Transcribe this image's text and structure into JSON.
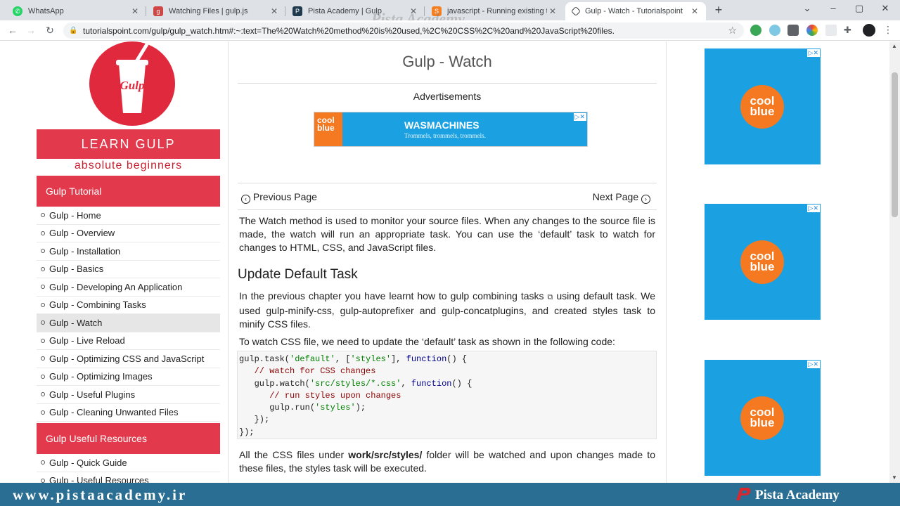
{
  "browser": {
    "tabs": [
      {
        "label": "WhatsApp",
        "color": "#25d366"
      },
      {
        "label": "Watching Files | gulp.js",
        "color": "#cf4647"
      },
      {
        "label": "Pista Academy | Gulp",
        "color": "#1f3a4d"
      },
      {
        "label": "javascript - Running existing task",
        "color": "#f48024"
      },
      {
        "label": "Gulp - Watch - Tutorialspoint",
        "color": "#3c4043"
      }
    ],
    "url": "tutorialspoint.com/gulp/gulp_watch.htm#:~:text=The%20Watch%20method%20is%20used,%2C%20CSS%2C%20and%20JavaScript%20files.",
    "new_tab": "+",
    "watermark": "Pista Academy"
  },
  "sidebar": {
    "logo_text": "Gulp",
    "learn_banner": "LEARN GULP",
    "learn_sub": "absolute beginners",
    "section1_title": "Gulp Tutorial",
    "items": [
      "Gulp - Home",
      "Gulp - Overview",
      "Gulp - Installation",
      "Gulp - Basics",
      "Gulp - Developing An Application",
      "Gulp - Combining Tasks",
      "Gulp - Watch",
      "Gulp - Live Reload",
      "Gulp - Optimizing CSS and JavaScript",
      "Gulp - Optimizing Images",
      "Gulp - Useful Plugins",
      "Gulp - Cleaning Unwanted Files"
    ],
    "current_item": "Gulp - Watch",
    "section2_title": "Gulp Useful Resources",
    "resources": [
      "Gulp - Quick Guide",
      "Gulp - Useful Resources"
    ]
  },
  "main": {
    "title": "Gulp - Watch",
    "ads_label": "Advertisements",
    "banner": {
      "brand": "cool blue",
      "title": "WASMACHINES",
      "subtitle": "Trommels, trommels, trommels."
    },
    "prev": "Previous Page",
    "next": "Next Page",
    "intro": "The Watch method is used to monitor your source files. When any changes to the source file is made, the watch will run an appropriate task. You can use the ‘default’ task to watch for changes to HTML, CSS, and JavaScript files.",
    "heading": "Update Default Task",
    "p2_before": "In the previous chapter you have learnt how to ",
    "p2_link": "gulp combining tasks",
    "p2_after": " using default task. We used gulp-minify-css, gulp-autoprefixer and gulp-concatplugins, and created styles task to minify CSS files.",
    "p3": "To watch CSS file, we need to update the ‘default’ task as shown in the following code:",
    "p4_before": "All the CSS files under ",
    "p4_bold": "work/src/styles/",
    "p4_after": " folder will be watched and upon changes made to these files, the styles task will be executed."
  },
  "right_ads": [
    {
      "brand": "cool blue"
    },
    {
      "brand": "cool blue"
    },
    {
      "brand": "cool blue"
    }
  ],
  "footer": {
    "url": "www.pistaacademy.ir",
    "name": "Pista Academy"
  }
}
